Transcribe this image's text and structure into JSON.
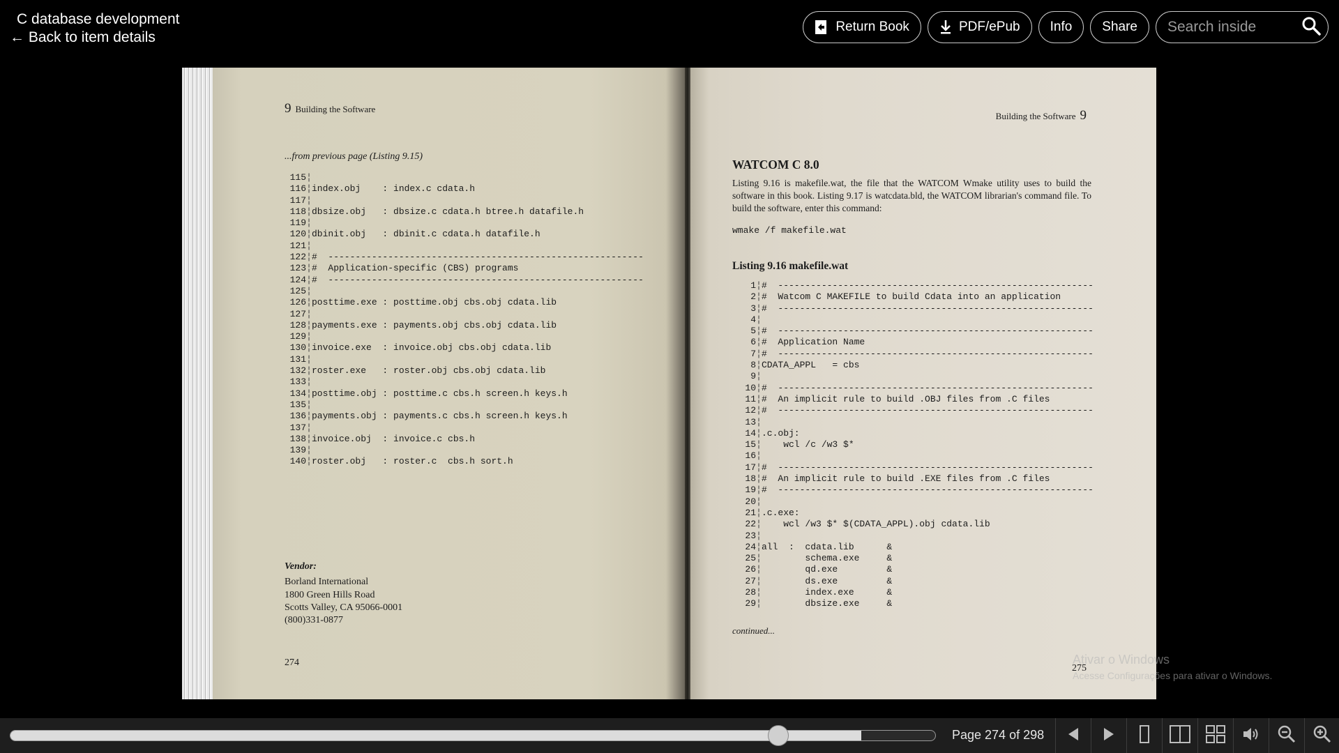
{
  "header": {
    "title": "C database development",
    "back_label": "← Back to item details",
    "buttons": {
      "return_book": "Return Book",
      "pdf_epub": "PDF/ePub",
      "info": "Info",
      "share": "Share"
    },
    "search_placeholder": "Search inside"
  },
  "left_page": {
    "running_head_num": "9",
    "running_head_text": "Building the Software",
    "continued_from": "...from previous page (Listing 9.15)",
    "code": [
      {
        "n": "115",
        "t": ""
      },
      {
        "n": "116",
        "t": "index.obj    : index.c cdata.h"
      },
      {
        "n": "117",
        "t": ""
      },
      {
        "n": "118",
        "t": "dbsize.obj   : dbsize.c cdata.h btree.h datafile.h"
      },
      {
        "n": "119",
        "t": ""
      },
      {
        "n": "120",
        "t": "dbinit.obj   : dbinit.c cdata.h datafile.h"
      },
      {
        "n": "121",
        "t": ""
      },
      {
        "n": "122",
        "t": "#  ----------------------------------------------------------"
      },
      {
        "n": "123",
        "t": "#  Application-specific (CBS) programs"
      },
      {
        "n": "124",
        "t": "#  ----------------------------------------------------------"
      },
      {
        "n": "125",
        "t": ""
      },
      {
        "n": "126",
        "t": "posttime.exe : posttime.obj cbs.obj cdata.lib"
      },
      {
        "n": "127",
        "t": ""
      },
      {
        "n": "128",
        "t": "payments.exe : payments.obj cbs.obj cdata.lib"
      },
      {
        "n": "129",
        "t": ""
      },
      {
        "n": "130",
        "t": "invoice.exe  : invoice.obj cbs.obj cdata.lib"
      },
      {
        "n": "131",
        "t": ""
      },
      {
        "n": "132",
        "t": "roster.exe   : roster.obj cbs.obj cdata.lib"
      },
      {
        "n": "133",
        "t": ""
      },
      {
        "n": "134",
        "t": "posttime.obj : posttime.c cbs.h screen.h keys.h"
      },
      {
        "n": "135",
        "t": ""
      },
      {
        "n": "136",
        "t": "payments.obj : payments.c cbs.h screen.h keys.h"
      },
      {
        "n": "137",
        "t": ""
      },
      {
        "n": "138",
        "t": "invoice.obj  : invoice.c cbs.h"
      },
      {
        "n": "139",
        "t": ""
      },
      {
        "n": "140",
        "t": "roster.obj   : roster.c  cbs.h sort.h"
      }
    ],
    "vendor": {
      "title": "Vendor:",
      "lines": [
        "Borland International",
        "1800 Green Hills Road",
        "Scotts Valley, CA 95066-0001",
        "(800)331-0877"
      ]
    },
    "folio": "274"
  },
  "right_page": {
    "running_head_text": "Building the Software",
    "running_head_num": "9",
    "section_title": "WATCOM C 8.0",
    "paragraph": "Listing 9.16 is makefile.wat, the file that the WATCOM Wmake utility uses to build the software in this book. Listing 9.17 is watcdata.bld, the WATCOM librarian's command file. To build the software, enter this command:",
    "command": "wmake /f makefile.wat",
    "listing_title": "Listing 9.16 makefile.wat",
    "code": [
      {
        "n": "1",
        "t": "#  ----------------------------------------------------------"
      },
      {
        "n": "2",
        "t": "#  Watcom C MAKEFILE to build Cdata into an application"
      },
      {
        "n": "3",
        "t": "#  ----------------------------------------------------------"
      },
      {
        "n": "4",
        "t": ""
      },
      {
        "n": "5",
        "t": "#  ----------------------------------------------------------"
      },
      {
        "n": "6",
        "t": "#  Application Name"
      },
      {
        "n": "7",
        "t": "#  ----------------------------------------------------------"
      },
      {
        "n": "8",
        "t": "CDATA_APPL   = cbs"
      },
      {
        "n": "9",
        "t": ""
      },
      {
        "n": "10",
        "t": "#  ----------------------------------------------------------"
      },
      {
        "n": "11",
        "t": "#  An implicit rule to build .OBJ files from .C files"
      },
      {
        "n": "12",
        "t": "#  ----------------------------------------------------------"
      },
      {
        "n": "13",
        "t": ""
      },
      {
        "n": "14",
        "t": ".c.obj:"
      },
      {
        "n": "15",
        "t": "    wcl /c /w3 $*"
      },
      {
        "n": "16",
        "t": ""
      },
      {
        "n": "17",
        "t": "#  ----------------------------------------------------------"
      },
      {
        "n": "18",
        "t": "#  An implicit rule to build .EXE files from .C files"
      },
      {
        "n": "19",
        "t": "#  ----------------------------------------------------------"
      },
      {
        "n": "20",
        "t": ""
      },
      {
        "n": "21",
        "t": ".c.exe:"
      },
      {
        "n": "22",
        "t": "    wcl /w3 $* $(CDATA_APPL).obj cdata.lib"
      },
      {
        "n": "23",
        "t": ""
      },
      {
        "n": "24",
        "t": "all  :  cdata.lib      &"
      },
      {
        "n": "25",
        "t": "        schema.exe     &"
      },
      {
        "n": "26",
        "t": "        qd.exe         &"
      },
      {
        "n": "27",
        "t": "        ds.exe         &"
      },
      {
        "n": "28",
        "t": "        index.exe      &"
      },
      {
        "n": "29",
        "t": "        dbsize.exe     &"
      }
    ],
    "continued_next": "continued...",
    "folio": "275"
  },
  "watermark": {
    "line1": "Ativar o Windows",
    "line2": "Acesse Configurações para ativar o Windows."
  },
  "bottom_bar": {
    "page_label": "Page 274 of 298",
    "progress_fraction": 0.92,
    "icons": [
      "prev-page-icon",
      "next-page-icon",
      "one-page-view-icon",
      "two-page-view-icon",
      "thumbnail-view-icon",
      "read-aloud-icon",
      "zoom-out-icon",
      "zoom-in-icon"
    ]
  }
}
